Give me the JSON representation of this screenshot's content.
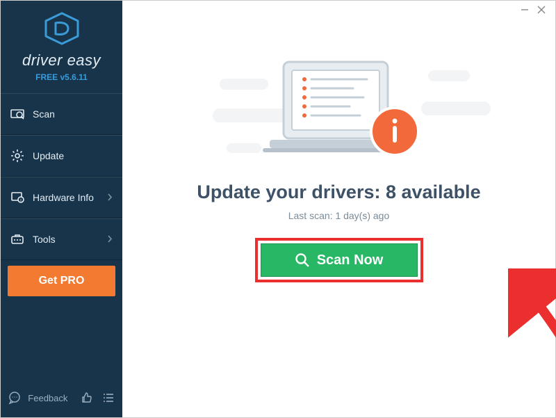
{
  "brand": {
    "name": "driver easy",
    "subline": "FREE v5.6.11"
  },
  "sidebar": {
    "items": [
      {
        "label": "Scan"
      },
      {
        "label": "Update"
      },
      {
        "label": "Hardware Info"
      },
      {
        "label": "Tools"
      }
    ],
    "get_pro": "Get PRO",
    "feedback": "Feedback"
  },
  "main": {
    "headline_prefix": "Update your drivers: ",
    "available_count": 8,
    "headline_suffix": " available",
    "last_scan": "Last scan: 1 day(s) ago",
    "scan_button": "Scan Now"
  }
}
